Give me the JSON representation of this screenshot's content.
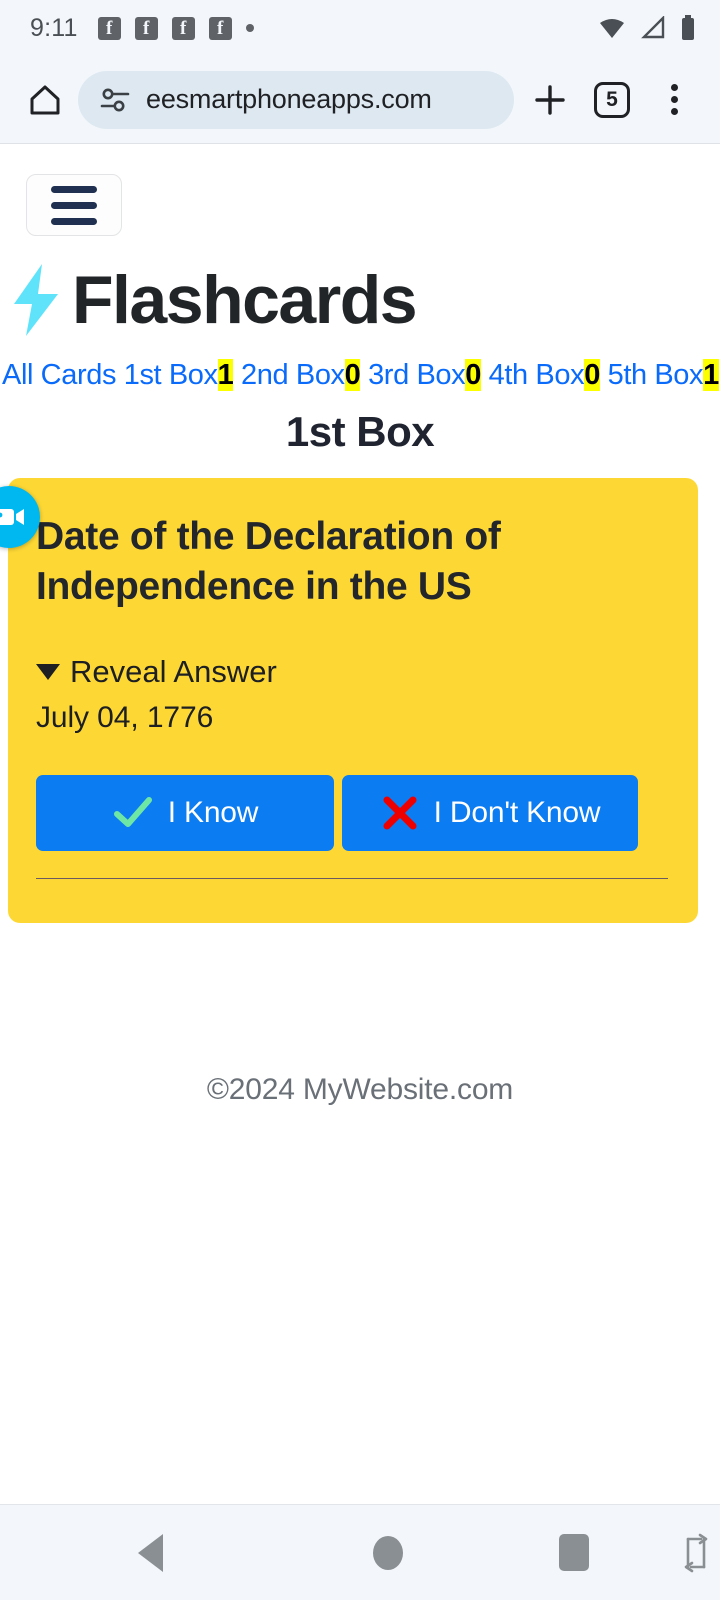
{
  "status_bar": {
    "time": "9:11",
    "notification_icons": [
      "facebook-icon",
      "facebook-icon",
      "facebook-icon",
      "facebook-icon",
      "more-notifications-dot"
    ],
    "facebook_glyph": "f",
    "right_icons": [
      "wifi-icon",
      "cellular-signal-icon",
      "battery-icon"
    ]
  },
  "browser": {
    "home_label": "home-icon",
    "permission_icon": "tune-icon",
    "url": "eesmartphoneapps.com",
    "new_tab_label": "+",
    "tab_count": "5",
    "menu_label": "more-options-icon"
  },
  "app": {
    "menu_button_label": "menu-icon",
    "logo_icon": "lightning-bolt-icon",
    "title": "Flashcards",
    "nav": [
      {
        "label": "All Cards",
        "count": null
      },
      {
        "label": "1st Box",
        "count": "1"
      },
      {
        "label": "2nd Box",
        "count": "0"
      },
      {
        "label": "3rd Box",
        "count": "0"
      },
      {
        "label": "4th Box",
        "count": "0"
      },
      {
        "label": "5th Box",
        "count": "1"
      }
    ],
    "box_title": "1st Box",
    "card": {
      "question": "Date of the Declaration of Independence in the US",
      "reveal_label": "Reveal Answer",
      "answer": "July 04, 1776",
      "know_button": "I Know",
      "dont_know_button": "I Don't Know",
      "know_icon": "check-icon",
      "dont_know_icon": "cross-icon"
    },
    "footer": "©2024 MyWebsite.com",
    "video_widget_icon": "video-camera-icon"
  },
  "colors": {
    "card_yellow": "#fdd835",
    "highlight_yellow": "#fcff00",
    "link_blue": "#0a6bfb",
    "button_blue": "#0b7cf2",
    "bolt_cyan": "#5fe3fb",
    "check_green": "#6ee7a5",
    "cross_red": "#ef0000",
    "widget_cyan": "#00b8f0"
  },
  "android_nav": {
    "back": "back-icon",
    "home": "home-circle-icon",
    "recents": "recents-icon",
    "rotate": "rotate-screen-icon"
  }
}
